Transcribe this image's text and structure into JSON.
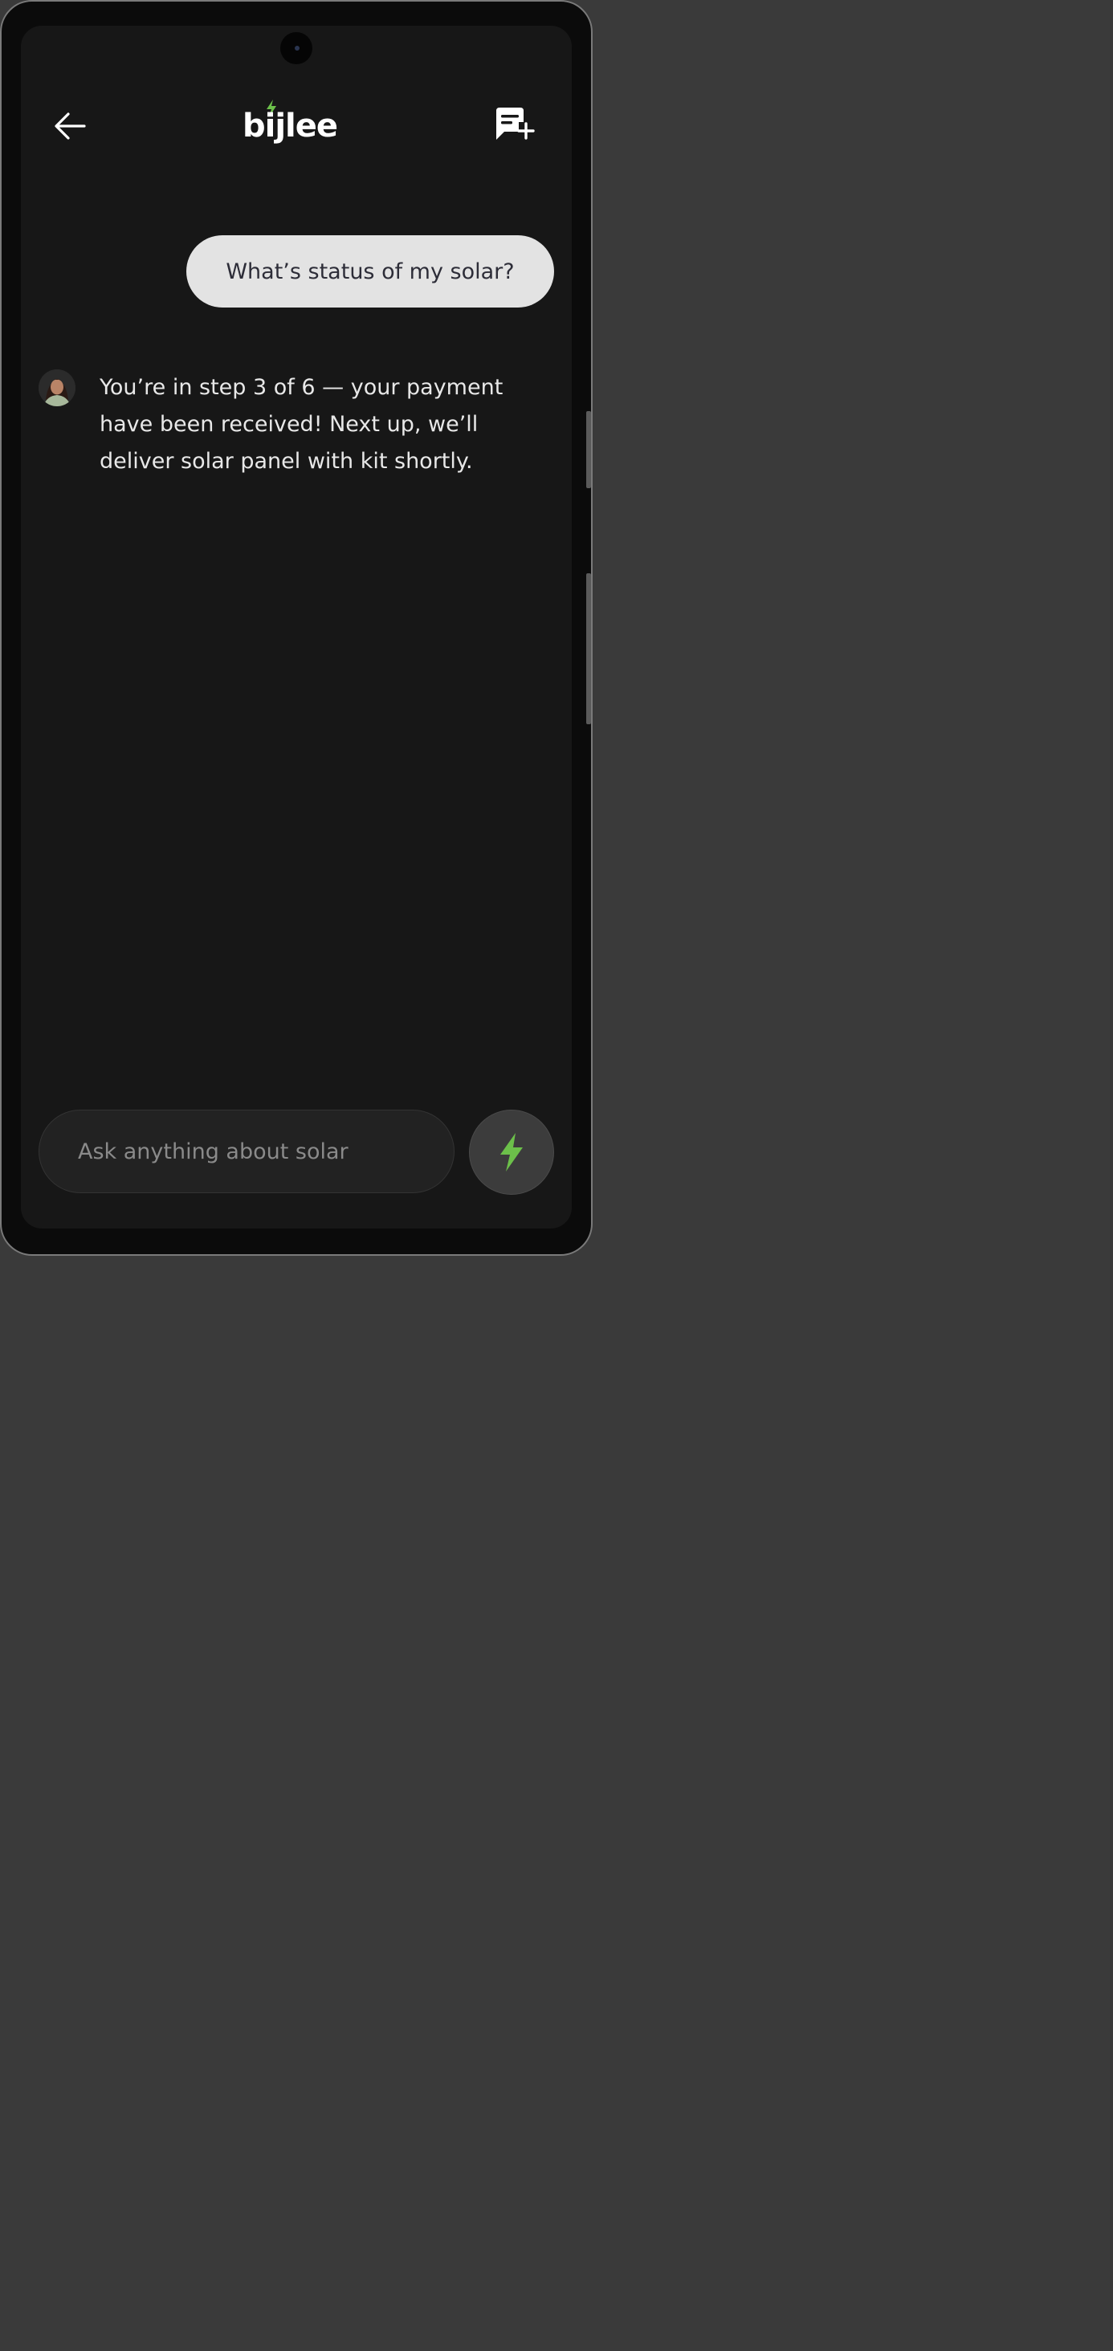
{
  "header": {
    "back_icon": "arrow-left-icon",
    "logo_text": "bijlee",
    "logo_accent_color": "#6cc04a",
    "new_chat_icon": "new-chat-icon"
  },
  "chat": {
    "messages": [
      {
        "role": "user",
        "text": "What’s status of my solar?"
      },
      {
        "role": "assistant",
        "text": "You’re in step 3 of 6 — your payment have been received! Next up, we’ll deliver solar panel with kit shortly."
      }
    ]
  },
  "composer": {
    "placeholder": "Ask anything about solar",
    "send_icon": "lightning-bolt-icon",
    "send_icon_color": "#6cc04a"
  }
}
